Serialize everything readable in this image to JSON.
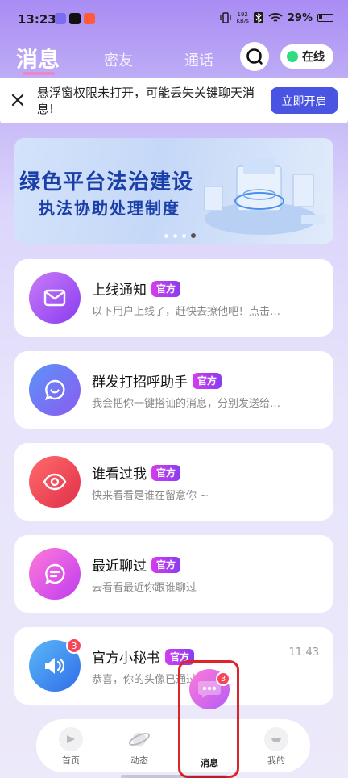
{
  "status_bar": {
    "time": "13:23",
    "net_speed_value": "192",
    "net_speed_unit": "KB/s",
    "battery": "29%"
  },
  "top_nav": {
    "tabs": [
      {
        "label": "消息",
        "active": true
      },
      {
        "label": "密友",
        "active": false
      },
      {
        "label": "通话",
        "active": false
      }
    ],
    "search_icon": "search-icon",
    "online_status": "在线",
    "online_color": "#2fdc7f"
  },
  "notice": {
    "text": "悬浮窗权限未打开，可能丢失关键聊天消息!",
    "button": "立即开启",
    "button_color": "#4a54e3"
  },
  "promo": {
    "line1": "绿色平台法治建设",
    "line2": "执法协助处理制度",
    "slides": 4,
    "active_slide": 3
  },
  "messages": [
    {
      "title": "上线通知",
      "badge": "官方",
      "subtitle": "以下用户上线了，赶快去撩他吧！点击…",
      "icon": "mail-icon",
      "time": "",
      "unread": ""
    },
    {
      "title": "群发打招呼助手",
      "badge": "官方",
      "subtitle": "我会把你一键搭讪的消息，分别发送给…",
      "icon": "smile-chat-icon",
      "time": "",
      "unread": ""
    },
    {
      "title": "谁看过我",
      "badge": "官方",
      "subtitle": "快来看看是谁在留意你 ~",
      "icon": "eye-icon",
      "time": "",
      "unread": ""
    },
    {
      "title": "最近聊过",
      "badge": "官方",
      "subtitle": "去看看最近你跟谁聊过",
      "icon": "chat-lines-icon",
      "time": "",
      "unread": ""
    },
    {
      "title": "官方小秘书",
      "badge": "官方",
      "subtitle": "恭喜，你的头像已通过审核！",
      "icon": "speaker-icon",
      "time": "11:43",
      "unread": "3"
    }
  ],
  "bottom_nav": {
    "items": [
      {
        "label": "首页",
        "icon": "home-icon"
      },
      {
        "label": "动态",
        "icon": "planet-icon"
      },
      {
        "label": "消息",
        "icon": "message-bubble-icon",
        "badge": "3",
        "active": true
      },
      {
        "label": "我的",
        "icon": "profile-icon"
      }
    ]
  }
}
